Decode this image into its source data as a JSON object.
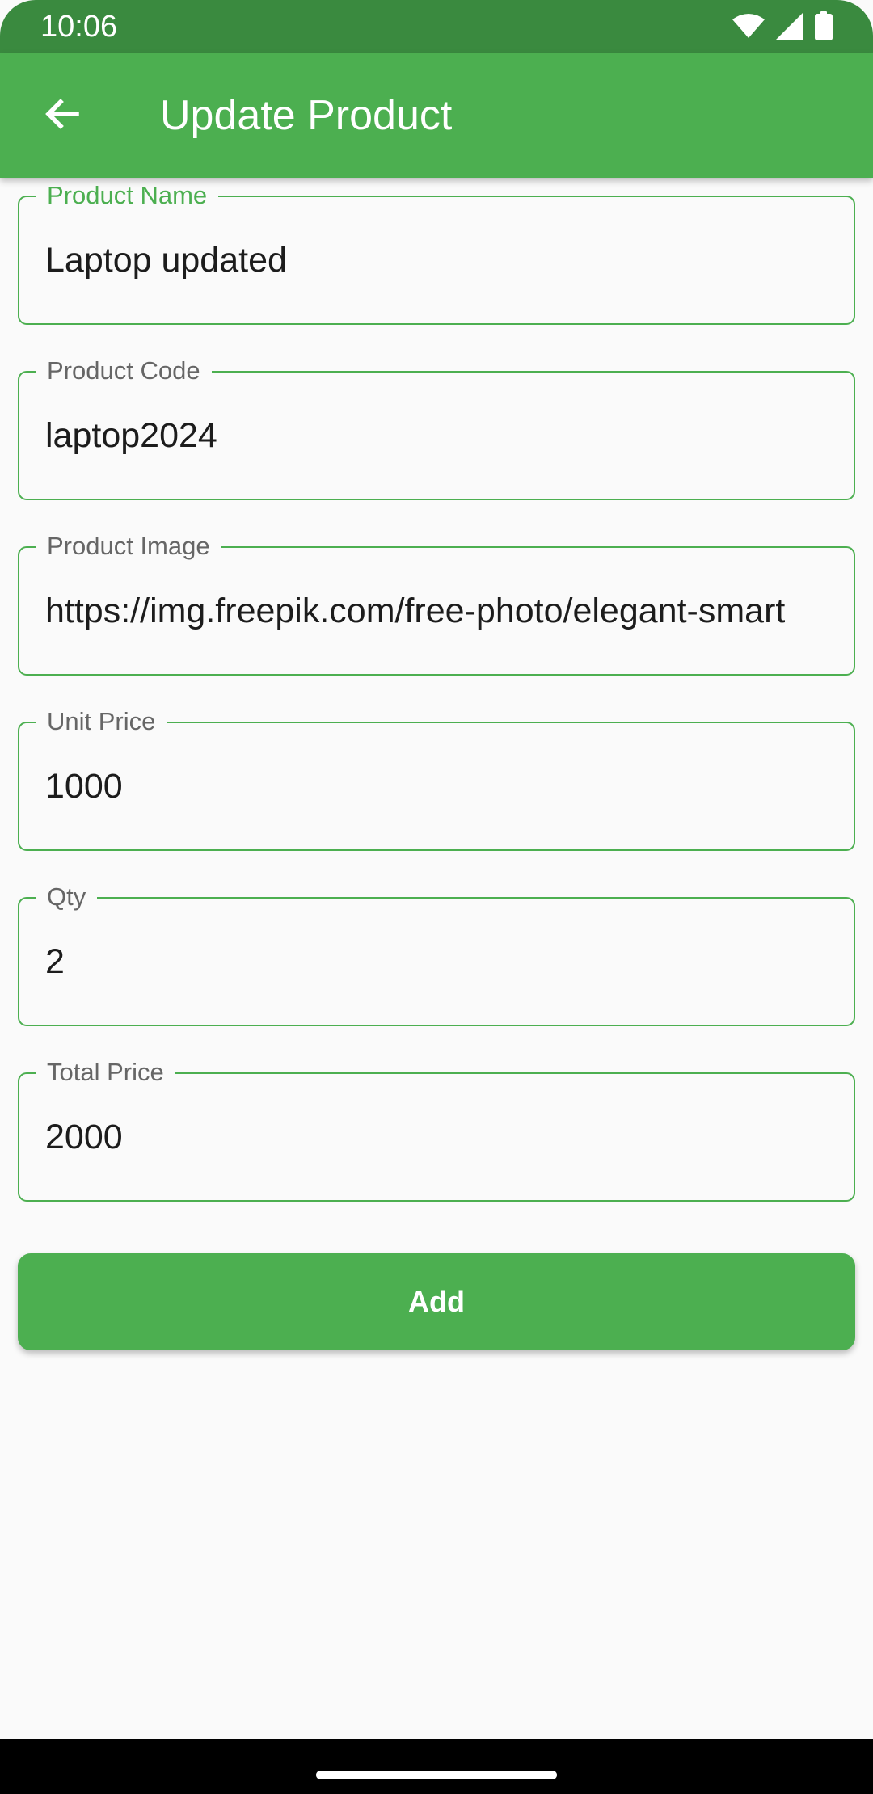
{
  "status_bar": {
    "time": "10:06",
    "icons": [
      "wifi-icon",
      "cellular-signal-icon",
      "battery-icon"
    ]
  },
  "app_bar": {
    "back_icon": "arrow-back-icon",
    "title": "Update Product"
  },
  "form": {
    "fields": [
      {
        "label": "Product Name",
        "value": "Laptop updated",
        "focused": true
      },
      {
        "label": "Product Code",
        "value": "laptop2024",
        "focused": false
      },
      {
        "label": "Product Image",
        "value": "https://img.freepik.com/free-photo/elegant-smart",
        "focused": false
      },
      {
        "label": "Unit Price",
        "value": "1000",
        "focused": false
      },
      {
        "label": "Qty",
        "value": "2",
        "focused": false
      },
      {
        "label": "Total Price",
        "value": "2000",
        "focused": false
      }
    ]
  },
  "submit_button": {
    "label": "Add"
  },
  "colors": {
    "primary": "#4caf50",
    "status_bar": "#3a8a3f",
    "background": "#fafafa",
    "label_muted": "#666666",
    "text": "#1c1c1c"
  }
}
